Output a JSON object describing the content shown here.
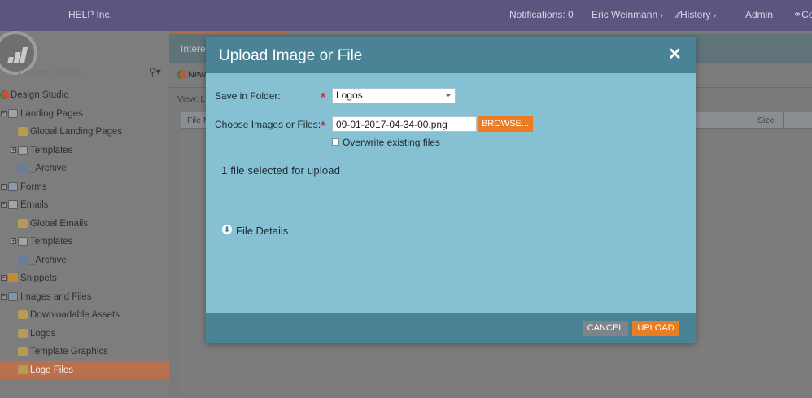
{
  "topbar": {
    "org": "HELP Inc.",
    "notifications": "Notifications: 0",
    "user": "Eric Weinmann",
    "history": "History",
    "admin": "Admin",
    "community": "Co"
  },
  "sidebar": {
    "search_placeholder": "Design Studio...",
    "tree": [
      {
        "label": "Design Studio",
        "icon": "globe-icon"
      },
      {
        "label": "Landing Pages",
        "icon": "page-icon"
      },
      {
        "label": "Global Landing Pages",
        "icon": "folder-icon"
      },
      {
        "label": "Templates",
        "icon": "page-icon"
      },
      {
        "label": "_Archive",
        "icon": "cube-icon"
      },
      {
        "label": "Forms",
        "icon": "form-icon"
      },
      {
        "label": "Emails",
        "icon": "email-icon"
      },
      {
        "label": "Global Emails",
        "icon": "folder-icon"
      },
      {
        "label": "Templates",
        "icon": "page-icon"
      },
      {
        "label": "_Archive",
        "icon": "cube-icon"
      },
      {
        "label": "Snippets",
        "icon": "snippet-icon"
      },
      {
        "label": "Images and Files",
        "icon": "images-icon"
      },
      {
        "label": "Downloadable Assets",
        "icon": "folder-icon"
      },
      {
        "label": "Logos",
        "icon": "folder-icon"
      },
      {
        "label": "Template Graphics",
        "icon": "folder-icon"
      },
      {
        "label": "Logo Files",
        "icon": "folder-icon",
        "selected": true
      }
    ]
  },
  "main": {
    "tab_label": "Intere",
    "new_label": "New",
    "view_label": "View: L",
    "col_file": "File N",
    "col_size": "Size"
  },
  "modal": {
    "title": "Upload Image or File",
    "folder_label": "Save in Folder:",
    "folder_value": "Logos",
    "files_label": "Choose Images or Files:",
    "file_value": "09-01-2017-04-34-00.png",
    "browse_label": "BROWSE...",
    "overwrite_label": "Overwrite existing files",
    "status": "1 file selected for upload",
    "details_label": "File Details",
    "cancel_label": "CANCEL",
    "upload_label": "UPLOAD"
  },
  "colors": {
    "accent": "#ea7c22",
    "modal_header": "#4a8396",
    "modal_body": "#86c1d3",
    "topbar": "#5b5680"
  }
}
